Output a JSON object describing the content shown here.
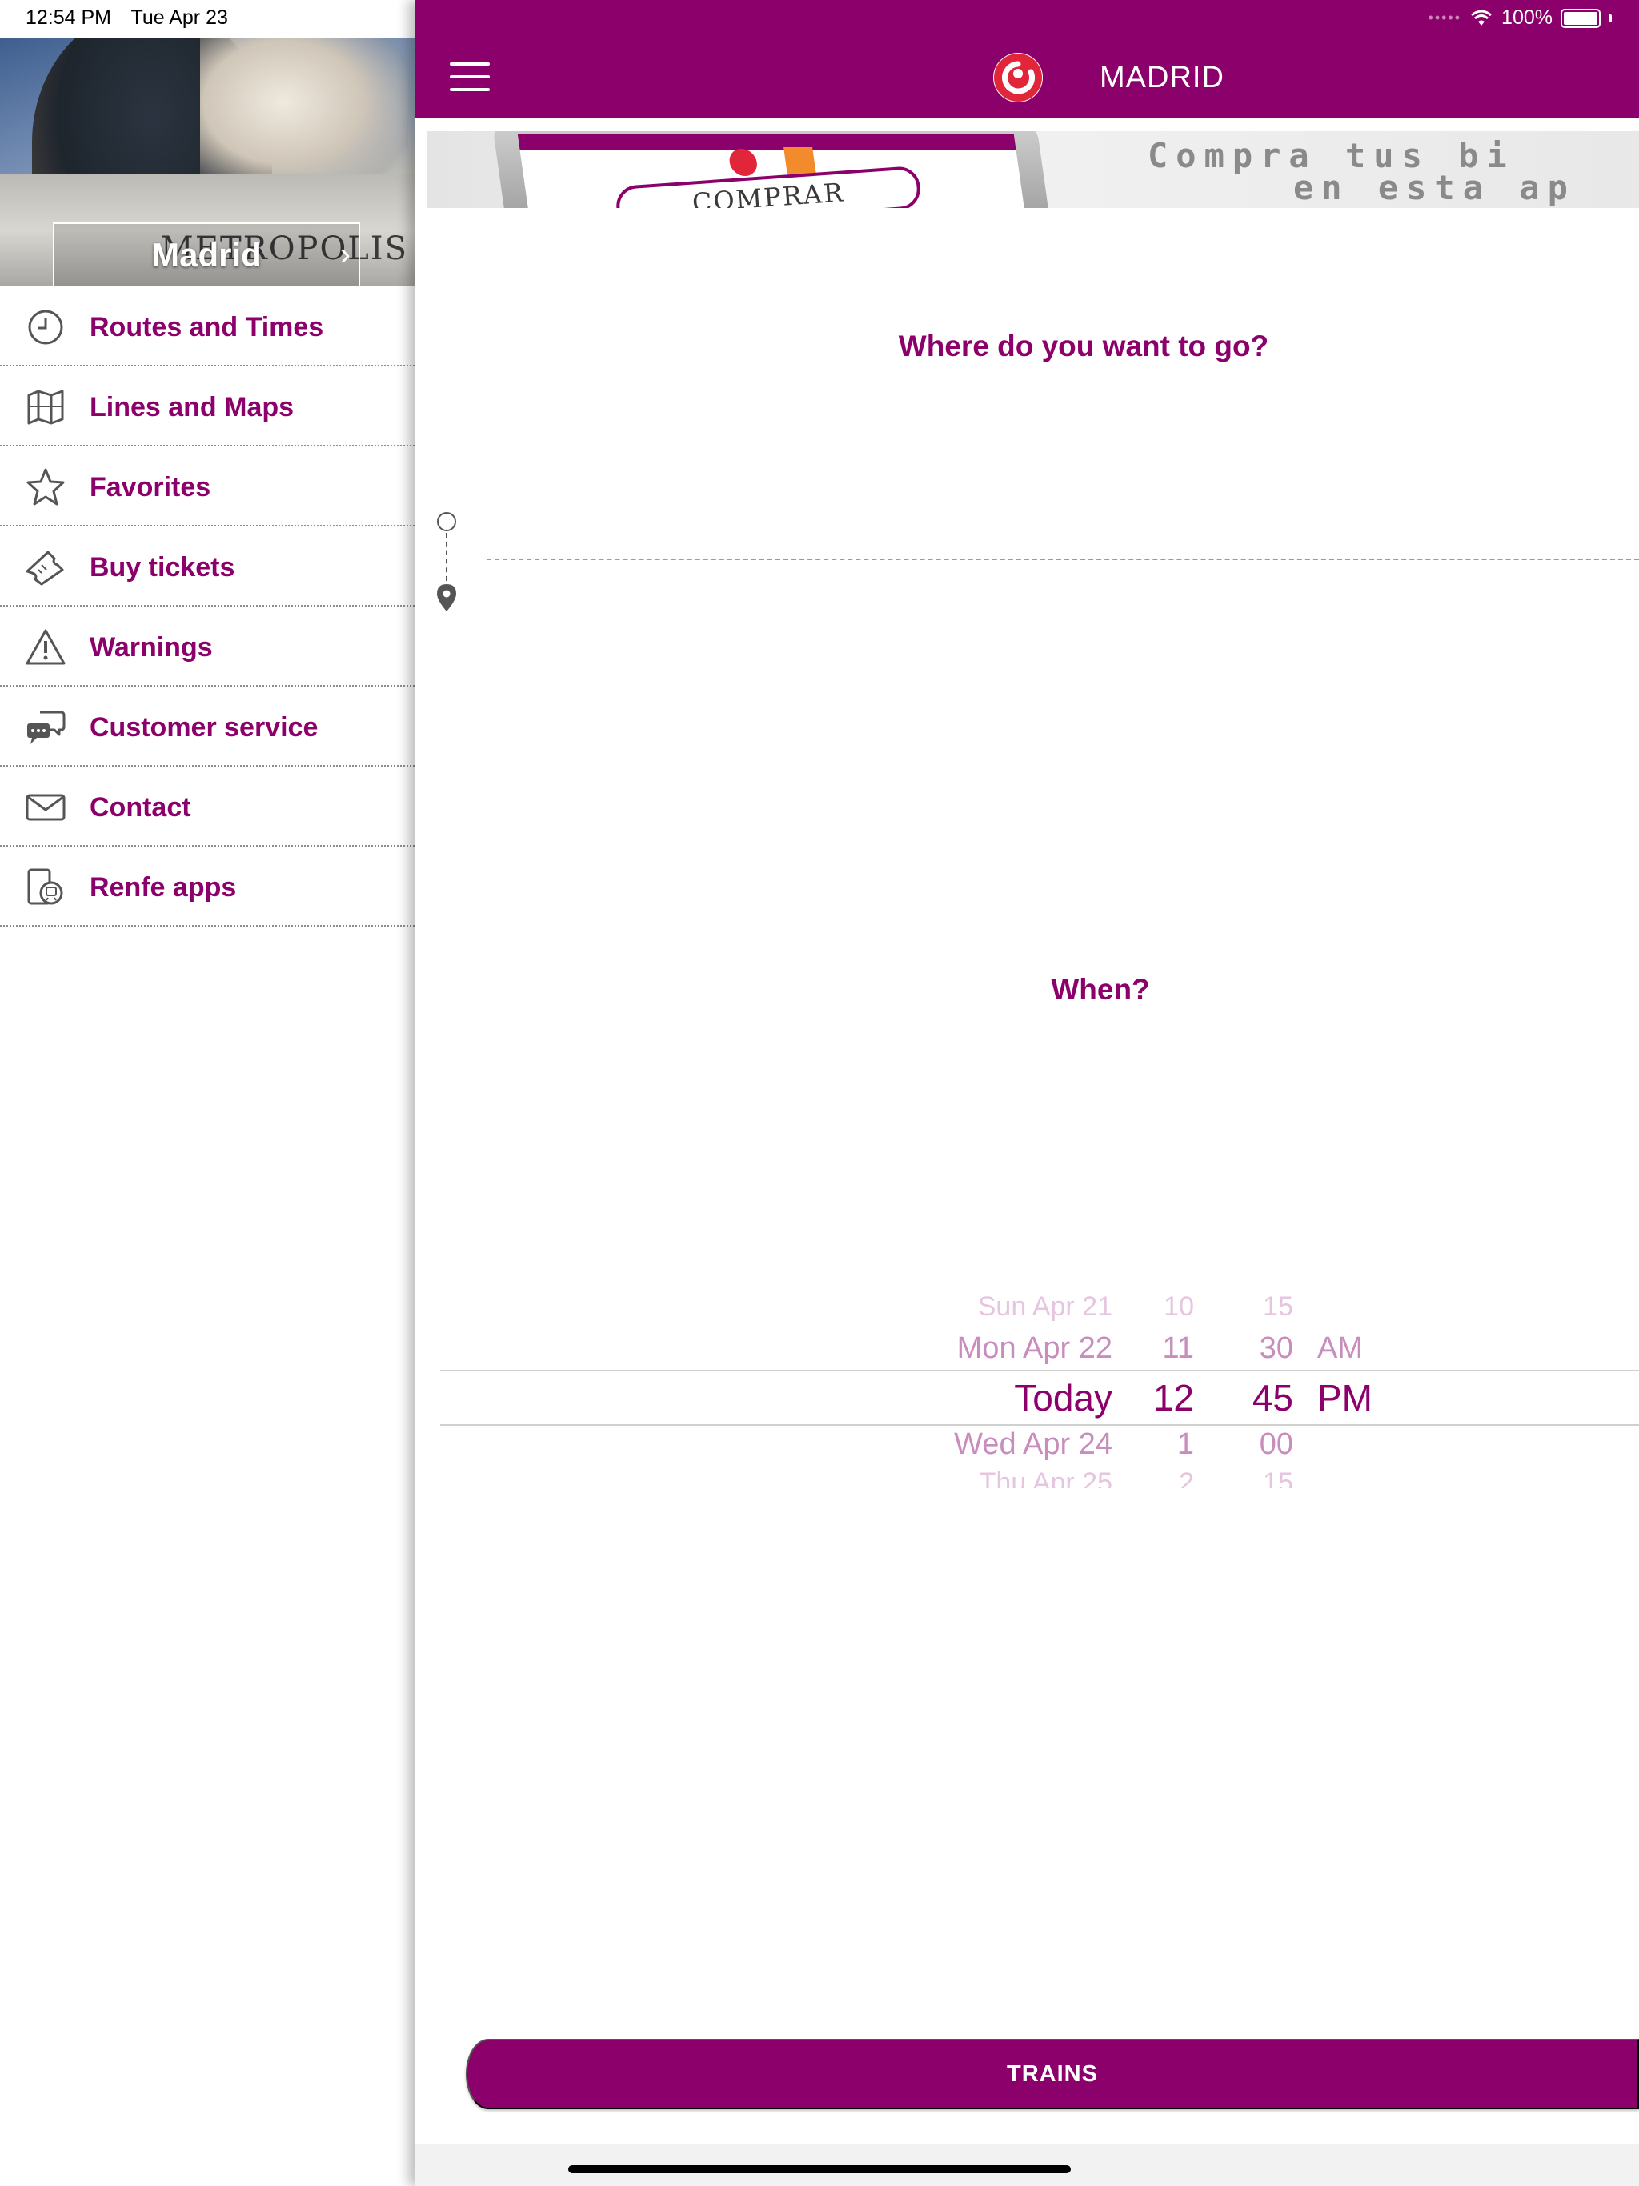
{
  "status_bar": {
    "time": "12:54 PM",
    "date": "Tue Apr 23",
    "battery": "100%"
  },
  "drawer": {
    "city": "Madrid",
    "banner_sign": "METROPOLIS",
    "items": [
      {
        "label": "Routes and Times",
        "icon": "clock-icon"
      },
      {
        "label": "Lines and Maps",
        "icon": "map-icon"
      },
      {
        "label": "Favorites",
        "icon": "star-icon"
      },
      {
        "label": "Buy tickets",
        "icon": "ticket-icon"
      },
      {
        "label": "Warnings",
        "icon": "warning-icon"
      },
      {
        "label": "Customer service",
        "icon": "chat-icon"
      },
      {
        "label": "Contact",
        "icon": "mail-icon"
      },
      {
        "label": "Renfe apps",
        "icon": "apps-icon"
      }
    ]
  },
  "header": {
    "title": "MADRID"
  },
  "ad": {
    "button_label": "COMPRAR",
    "line1": "Compra tus bi",
    "line2": "en esta ap"
  },
  "search": {
    "where_title": "Where do you want to go?",
    "when_title": "When?"
  },
  "picker": {
    "dates": [
      "Sun Apr 21",
      "Mon Apr 22",
      "Today",
      "Wed Apr 24",
      "Thu Apr 25"
    ],
    "hours": [
      "10",
      "11",
      "12",
      "1",
      "2"
    ],
    "minutes": [
      "15",
      "30",
      "45",
      "00",
      "15"
    ],
    "periods": [
      "",
      "AM",
      "PM",
      "",
      ""
    ],
    "selected_index": 2
  },
  "actions": {
    "trains_label": "TRAINS"
  },
  "colors": {
    "brand": "#8c006c",
    "logo_red": "#e2263a"
  }
}
